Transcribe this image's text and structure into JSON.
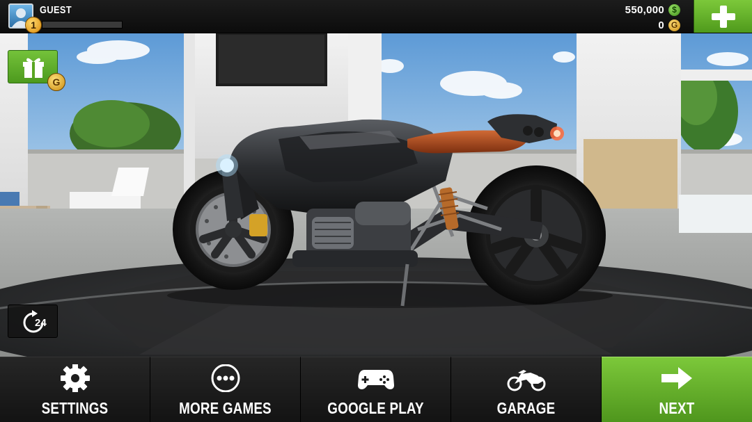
{
  "player": {
    "name": "GUEST",
    "level": "1",
    "xp_progress": 0
  },
  "currency": {
    "cash": "550,000",
    "cash_icon": "$",
    "gold": "0",
    "gold_icon": "G"
  },
  "buttons": {
    "add_icon": "plus-icon",
    "gift_icon": "gift-icon",
    "gift_coin": "G",
    "timer_label": "24"
  },
  "nav": {
    "items": [
      {
        "label": "SETTINGS",
        "icon": "gear-icon"
      },
      {
        "label": "MORE GAMES",
        "icon": "more-dots-icon"
      },
      {
        "label": "GOOGLE PLAY",
        "icon": "gamepad-icon"
      },
      {
        "label": "GARAGE",
        "icon": "motorcycle-icon"
      },
      {
        "label": "NEXT",
        "icon": "arrow-right-icon"
      }
    ]
  },
  "colors": {
    "accent_green": "#6ab82e",
    "bar_dark": "#131313",
    "seat_brown": "#a4481c"
  }
}
